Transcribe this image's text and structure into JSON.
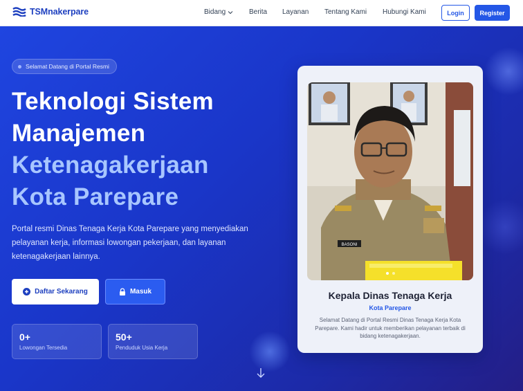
{
  "nav": {
    "logo_text": "TSMnakerpare",
    "links": [
      "Bidang",
      "Berita",
      "Layanan",
      "Tentang Kami",
      "Hubungi Kami"
    ],
    "login": "Login",
    "register": "Register"
  },
  "hero": {
    "badge": "Selamat Datang di Portal Resmi",
    "title_lines": [
      "Teknologi Sistem",
      "Manajemen",
      "Ketenagakerjaan",
      "Kota Parepare"
    ],
    "description": "Portal resmi Dinas Tenaga Kerja Kota Parepare yang menyediakan pelayanan kerja, informasi lowongan pekerjaan, dan layanan ketenagakerjaan lainnya.",
    "primary_button": "Daftar Sekarang",
    "secondary_button": "Masuk",
    "stats": [
      {
        "value": "0+",
        "label": "Lowongan Tersedia"
      },
      {
        "value": "50+",
        "label": "Penduduk Usia Kerja"
      }
    ]
  },
  "profile_card": {
    "name_tag": "BASONI",
    "title": "Kepala Dinas Tenaga Kerja",
    "subtitle": "Kota Parepare",
    "text": "Selamat Datang di Portal Resmi Dinas Tenaga Kerja Kota Parepare. Kami hadir untuk memberikan pelayanan terbaik di bidang ketenagakerjaan.",
    "carousel_active": 0,
    "carousel_count": 2
  },
  "colors": {
    "brand": "#1d3fbf",
    "accent": "#2457e6",
    "hero_bg": "#1a36c9",
    "title_accent": "#a8c6ff"
  },
  "icons": {
    "logo": "waves-logo-icon",
    "bidang_dropdown": "chevron-down-icon",
    "daftar": "plus-circle-icon",
    "masuk": "lock-icon",
    "scroll": "arrow-down-icon"
  }
}
